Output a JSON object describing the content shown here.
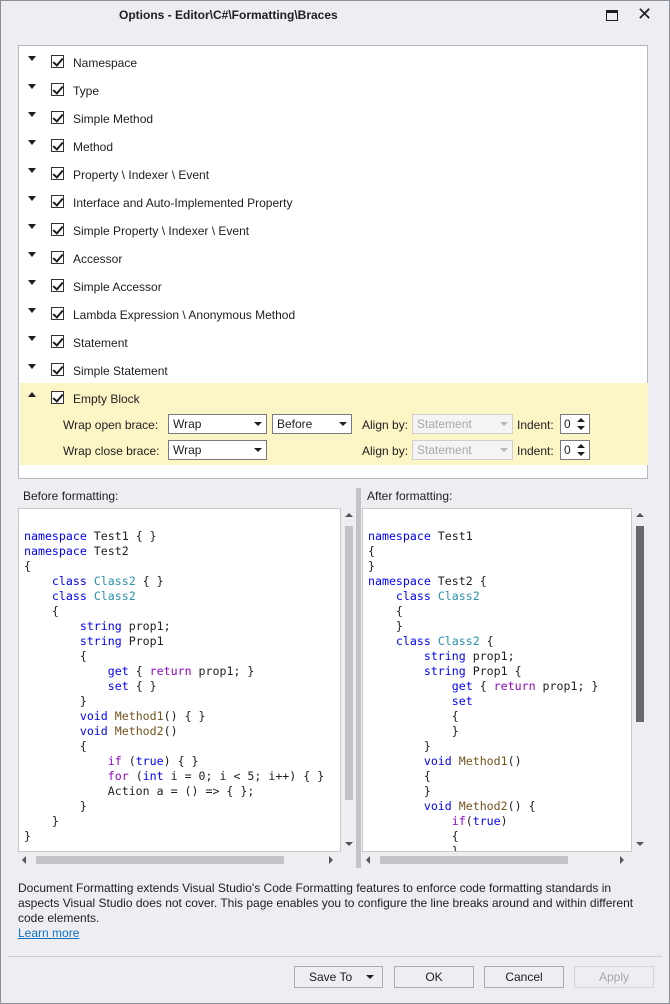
{
  "window": {
    "title": "Options - Editor\\C#\\Formatting\\Braces"
  },
  "rules": [
    {
      "label": "Namespace",
      "checked": true
    },
    {
      "label": "Type",
      "checked": true
    },
    {
      "label": "Simple Method",
      "checked": true
    },
    {
      "label": "Method",
      "checked": true
    },
    {
      "label": "Property \\ Indexer \\ Event",
      "checked": true
    },
    {
      "label": "Interface and Auto-Implemented Property",
      "checked": true
    },
    {
      "label": "Simple Property \\ Indexer \\ Event",
      "checked": true
    },
    {
      "label": "Accessor",
      "checked": true
    },
    {
      "label": "Simple Accessor",
      "checked": true
    },
    {
      "label": "Lambda Expression \\ Anonymous Method",
      "checked": true
    },
    {
      "label": "Statement",
      "checked": true
    },
    {
      "label": "Simple Statement",
      "checked": true
    },
    {
      "label": "Empty Block",
      "checked": true,
      "expanded": true
    }
  ],
  "empty_block": {
    "open": {
      "label": "Wrap open brace:",
      "wrap": "Wrap",
      "position": "Before",
      "align_label": "Align by:",
      "align": "Statement",
      "indent_label": "Indent:",
      "indent": "0"
    },
    "close": {
      "label": "Wrap close brace:",
      "wrap": "Wrap",
      "align_label": "Align by:",
      "align": "Statement",
      "indent_label": "Indent:",
      "indent": "0"
    }
  },
  "preview": {
    "before_label": "Before formatting:",
    "after_label": "After formatting:"
  },
  "description": "Document Formatting extends Visual Studio's Code Formatting features to enforce code formatting standards in aspects Visual Studio does not cover. This page enables you to configure the line breaks around and within different code elements.",
  "learn_more": "Learn more",
  "buttons": {
    "save_to": "Save To",
    "ok": "OK",
    "cancel": "Cancel",
    "apply": "Apply"
  }
}
